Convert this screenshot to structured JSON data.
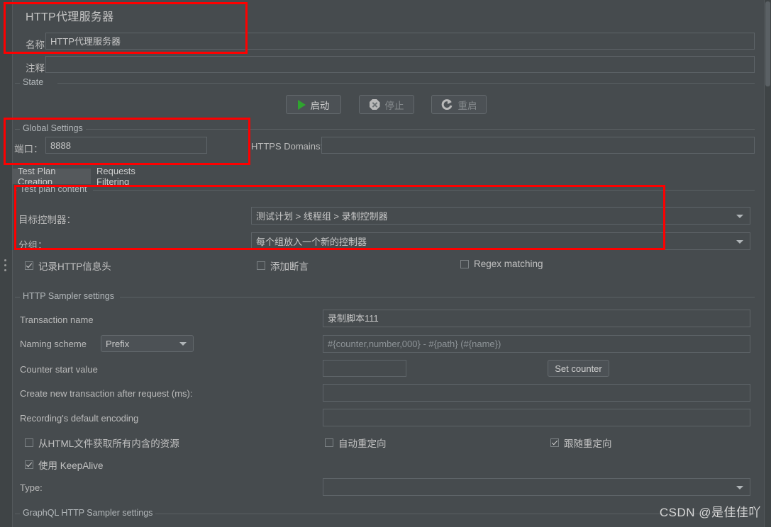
{
  "window": {
    "title": "HTTP代理服务器"
  },
  "header": {
    "name_label": "名称：",
    "name_value": "HTTP代理服务器",
    "comments_label": "注释：",
    "comments_value": ""
  },
  "state": {
    "group_title": "State",
    "start_button": "启动",
    "stop_button": "停止",
    "restart_button": "重启",
    "start_icon": "play-icon",
    "stop_icon": "stop-icon",
    "restart_icon": "restart-icon"
  },
  "global_settings": {
    "group_title": "Global Settings",
    "port_label": "端口：",
    "port_value": "8888",
    "https_domains_label": "HTTPS Domains:",
    "https_domains_value": ""
  },
  "tabs": [
    {
      "label": "Test Plan Creation",
      "active": true
    },
    {
      "label": "Requests Filtering",
      "active": false
    }
  ],
  "test_plan_content": {
    "group_title": "Test plan content",
    "target_controller_label": "目标控制器：",
    "target_controller_value": "测试计划 > 线程组 > 录制控制器",
    "grouping_label": "分组：",
    "grouping_value": "每个组放入一个新的控制器",
    "checkboxes": [
      {
        "label": "记录HTTP信息头",
        "checked": true
      },
      {
        "label": "添加断言",
        "checked": false
      },
      {
        "label": "Regex matching",
        "checked": false
      }
    ]
  },
  "http_sampler_settings": {
    "group_title": "HTTP Sampler settings",
    "transaction_name_label": "Transaction name",
    "transaction_name_value": "录制脚本111",
    "naming_scheme_label": "Naming scheme",
    "naming_scheme_value": "Prefix",
    "naming_pattern_placeholder": "#{counter,number,000} - #{path} (#{name})",
    "naming_pattern_value": "",
    "counter_start_label": "Counter start value",
    "counter_start_value": "",
    "set_counter_button": "Set counter",
    "create_new_transaction_label": "Create new transaction after request (ms):",
    "create_new_transaction_value": "",
    "default_encoding_label": "Recording's default encoding",
    "default_encoding_value": "",
    "checkboxes": [
      {
        "label": "从HTML文件获取所有内含的资源",
        "checked": false
      },
      {
        "label": "自动重定向",
        "checked": false
      },
      {
        "label": "跟随重定向",
        "checked": true
      },
      {
        "label": "使用 KeepAlive",
        "checked": true
      }
    ],
    "type_label": "Type:",
    "type_value": ""
  },
  "graphql_settings": {
    "group_title": "GraphQL HTTP Sampler settings"
  },
  "watermark": "CSDN @是佳佳吖",
  "colors": {
    "background": "#464b4e",
    "field_border": "#5e6468",
    "annotation": "#fe0000",
    "accent_green": "#2fa42f",
    "text": "#bbbbbb"
  }
}
